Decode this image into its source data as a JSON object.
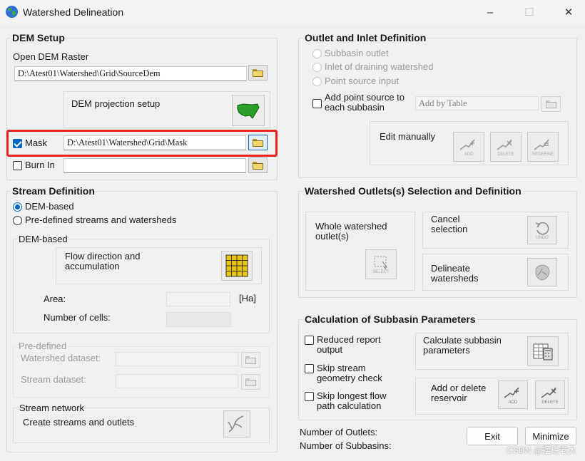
{
  "window": {
    "title": "Watershed Delineation",
    "minimize_icon": "–",
    "maximize_icon": "☐",
    "close_icon": "✕"
  },
  "dem_setup": {
    "title": "DEM Setup",
    "open_dem_label": "Open DEM Raster",
    "dem_path": "D:\\Atest01\\Watershed\\Grid\\SourceDem",
    "projection_label": "DEM projection setup",
    "mask_label": "Mask",
    "mask_checked": true,
    "mask_path": "D:\\Atest01\\Watershed\\Grid\\Mask",
    "burn_in_label": "Burn In",
    "burn_in_checked": false,
    "burn_in_path": ""
  },
  "stream_definition": {
    "title": "Stream Definition",
    "option_dem": "DEM-based",
    "option_predefined": "Pre-defined streams and watersheds",
    "dem_based_title": "DEM-based",
    "flow_label": "Flow direction and\naccumulation",
    "area_label": "Area:",
    "area_unit": "[Ha]",
    "cells_label": "Number of cells:",
    "predefined_title": "Pre-defined",
    "watershed_dataset_label": "Watershed dataset:",
    "stream_dataset_label": "Stream dataset:",
    "network_title": "Stream network",
    "create_label": "Create streams and outlets"
  },
  "outlet_inlet": {
    "title": "Outlet and Inlet Definition",
    "opt_subbasin": "Subbasin outlet",
    "opt_inlet": "Inlet of draining watershed",
    "opt_point": "Point source input",
    "add_point_label": "Add point source to\neach subbasin",
    "add_by_table": "Add by Table",
    "edit_manually": "Edit manually",
    "add_caption": "ADD",
    "delete_caption": "DELETE",
    "redefine_caption": "REDEFINE"
  },
  "watershed_outlets": {
    "title": "Watershed Outlets(s) Selection and Definition",
    "whole_label": "Whole watershed\noutlet(s)",
    "select_caption": "SELECT",
    "cancel_label": "Cancel\nselection",
    "undo_caption": "UNDO",
    "delineate_label": "Delineate\nwatersheds"
  },
  "subbasin_params": {
    "title": "Calculation of Subbasin Parameters",
    "reduced_label": "Reduced  report\noutput",
    "skip_stream_label": "Skip stream\ngeometry check",
    "skip_longest_label": "Skip longest flow\npath calculation",
    "calc_label": "Calculate subbasin\nparameters",
    "reservoir_label": "Add or delete\nreservoir",
    "add_caption": "ADD",
    "delete_caption": "DELETE"
  },
  "footer": {
    "outlets_label": "Number of Outlets:",
    "subbasins_label": "Number of Subbasins:",
    "exit_label": "Exit",
    "minimize_label": "Minimize"
  },
  "watermark": "CSDN @摆烂老大",
  "colors": {
    "accent": "#0067c0",
    "highlight": "#e8231d"
  }
}
